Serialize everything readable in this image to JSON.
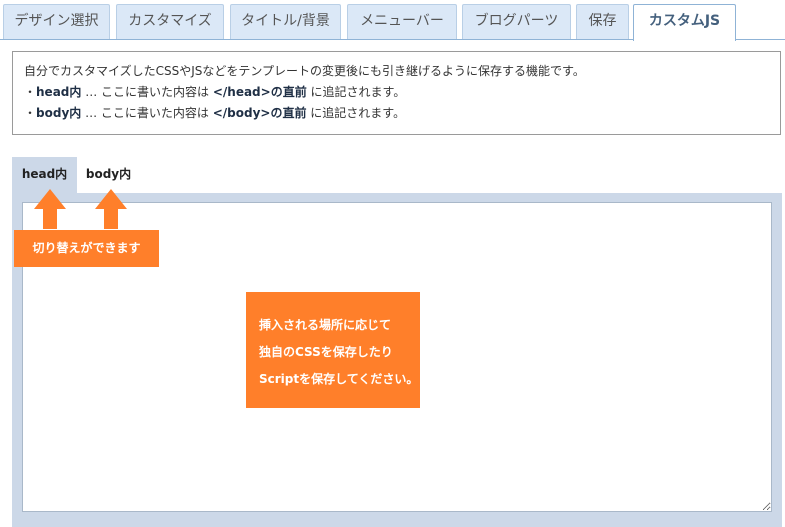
{
  "tabs": [
    {
      "label": "デザイン選択",
      "active": false
    },
    {
      "label": "カスタマイズ",
      "active": false
    },
    {
      "label": "タイトル/背景",
      "active": false
    },
    {
      "label": "メニューバー",
      "active": false
    },
    {
      "label": "ブログパーツ",
      "active": false
    },
    {
      "label": "保存",
      "active": false
    },
    {
      "label": "カスタムJS",
      "active": true
    }
  ],
  "info": {
    "intro": "自分でカスタマイズしたCSSやJSなどをテンプレートの変更後にも引き継げるように保存する機能です。",
    "head_line": {
      "bullet": "・",
      "name": "head内",
      "mid": " … ここに書いた内容は ",
      "emph": "</head>の直前",
      "tail": " に追記されます。"
    },
    "body_line": {
      "bullet": "・",
      "name": "body内",
      "mid": " … ここに書いた内容は ",
      "emph": "</body>の直前",
      "tail": " に追記されます。"
    }
  },
  "subtabs": [
    {
      "label": "head内",
      "active": true
    },
    {
      "label": "body内",
      "active": false
    }
  ],
  "editor": {
    "value": ""
  },
  "annotations": {
    "switch_label": "切り替えができます",
    "note_lines": [
      "挿入される場所に応じて",
      "独自のCSSを保存したり",
      "Scriptを保存してください。"
    ],
    "color": "#ff7f2a"
  },
  "colors": {
    "tab_bg": "#dbe8f7",
    "tab_active_text": "#44607d",
    "editor_frame": "#ccd8e8"
  }
}
